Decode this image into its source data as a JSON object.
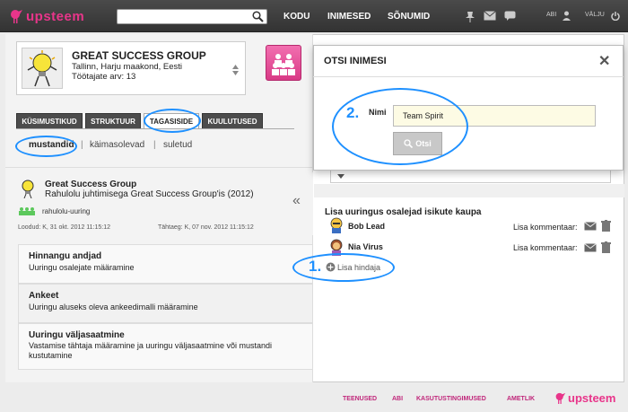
{
  "header": {
    "logo_text": "upsteem",
    "search": {
      "value": "",
      "placeholder": ""
    },
    "nav": [
      "KODU",
      "INIMESED",
      "SÕNUMID"
    ],
    "links": {
      "help": "ABI",
      "logout": "VÄLJU"
    }
  },
  "profile": {
    "name": "GREAT SUCCESS GROUP",
    "location": "Tallinn, Harju maakond, Eesti",
    "employees": "Töötajate arv: 13"
  },
  "tabs": [
    "KÜSIMUSTIKUD",
    "STRUKTUUR",
    "TAGASISIDE",
    "KUULUTUSED"
  ],
  "subtabs": [
    "mustandid",
    "käimasolevad",
    "suletud"
  ],
  "survey": {
    "org": "Great Success Group",
    "title": "Rahulolu juhtimisega Great Success Group'is (2012)",
    "tag": "rahulolu-uuring",
    "created": "Loodud: K, 31 okt. 2012 11:15:12",
    "deadline": "Tähtaeg: K, 07 nov. 2012 11:15:12",
    "collapse": "«"
  },
  "sections": [
    {
      "title": "Hinnangu andjad",
      "desc": "Uuringu osalejate määramine"
    },
    {
      "title": "Ankeet",
      "desc": "Uuringu aluseks oleva ankeedimalli määramine"
    },
    {
      "title": "Uuringu väljasaatmine",
      "desc": "Vastamise tähtaja määramine ja uuringu väljasaatmine või mustandi kustutamine"
    }
  ],
  "modal": {
    "title": "OTSI INIMESI",
    "close": "✕",
    "name_label": "Nimi",
    "name_value": "Team Spirit",
    "search_button": "Otsi"
  },
  "participants": {
    "heading": "Lisa uuringus osalejad isikute kaupa",
    "people": [
      {
        "name": "Bob Lead",
        "comment": "Lisa kommentaar:"
      },
      {
        "name": "Nia Virus",
        "comment": "Lisa kommentaar:"
      }
    ],
    "add_rater": "Lisa hindaja"
  },
  "annotations": {
    "step1": "1.",
    "step2": "2."
  },
  "footer": {
    "links": [
      "TEENUSED",
      "ABI",
      "KASUTUSTINGIMUSED",
      "AMETLIK"
    ],
    "logo_text": "upsteem"
  },
  "colors": {
    "brand": "#e8358a",
    "highlight": "#1e90ff",
    "topbar": "#3a3a3a"
  }
}
